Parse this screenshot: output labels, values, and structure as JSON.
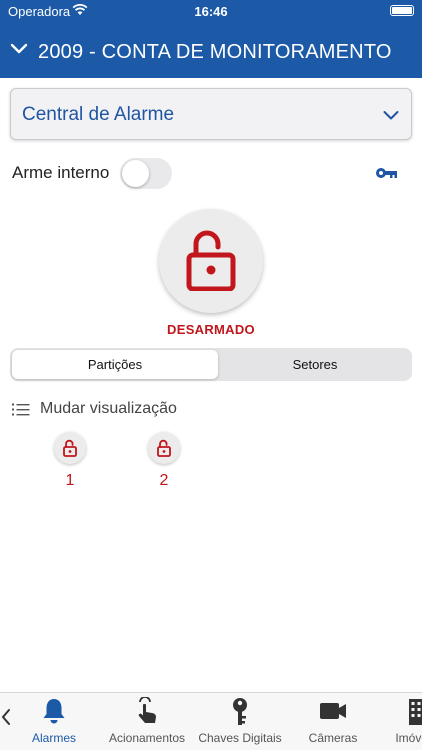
{
  "status_bar": {
    "carrier": "Operadora",
    "time": "16:46"
  },
  "header": {
    "title": "2009 - CONTA DE MONITORAMENTO"
  },
  "device_select": {
    "selected": "Central de Alarme"
  },
  "internal_arm": {
    "label": "Arme interno",
    "enabled": false
  },
  "alarm": {
    "state_label": "DESARMADO"
  },
  "segments": {
    "partitions": "Partições",
    "sectors": "Setores",
    "active": "partitions"
  },
  "view_toggle": {
    "label": "Mudar visualização"
  },
  "partitions": [
    {
      "number": "1",
      "status": "disarmed"
    },
    {
      "number": "2",
      "status": "disarmed"
    }
  ],
  "tabs": [
    {
      "label": "Alarmes",
      "icon": "bell-icon",
      "active": true
    },
    {
      "label": "Acionamentos",
      "icon": "hand-tap-icon",
      "active": false
    },
    {
      "label": "Chaves Digitais",
      "icon": "key-icon",
      "active": false
    },
    {
      "label": "Câmeras",
      "icon": "video-camera-icon",
      "active": false
    },
    {
      "label": "Imóveis",
      "icon": "building-icon",
      "active": false
    }
  ],
  "colors": {
    "brand": "#1c5aa8",
    "alarm_red": "#c0161c",
    "select_text": "#1f55a3"
  }
}
